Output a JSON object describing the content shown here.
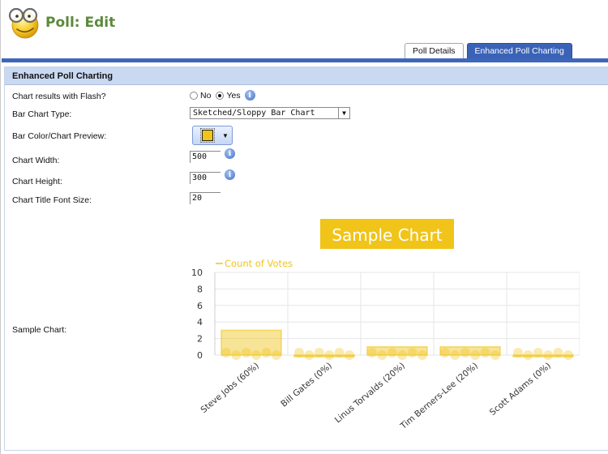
{
  "header": {
    "title": "Poll: Edit"
  },
  "tabs": [
    {
      "label": "Poll Details",
      "active": false
    },
    {
      "label": "Enhanced Poll Charting",
      "active": true
    }
  ],
  "section": {
    "title": "Enhanced Poll Charting"
  },
  "fields": {
    "flash": {
      "label": "Chart results with Flash?",
      "options": [
        "No",
        "Yes"
      ],
      "selected": "Yes"
    },
    "bar_chart_type": {
      "label": "Bar Chart Type:",
      "value": "Sketched/Sloppy Bar Chart"
    },
    "bar_color": {
      "label": "Bar Color/Chart Preview:",
      "color": "#f0c419"
    },
    "chart_width": {
      "label": "Chart Width:",
      "value": "500"
    },
    "chart_height": {
      "label": "Chart Height:",
      "value": "300"
    },
    "title_font_size": {
      "label": "Chart Title Font Size:",
      "value": "20"
    },
    "sample_chart": {
      "label": "Sample Chart:"
    }
  },
  "colors": {
    "accent": "#3a63b8",
    "bar": "#f0c419",
    "title_green": "#5b8a3c"
  },
  "icons": {
    "logo": "smiley-glasses-icon",
    "info": "info-icon"
  },
  "chart_data": {
    "type": "bar",
    "title": "Sample Chart",
    "legend": "Count of Votes",
    "legend_position": "top-left",
    "categories": [
      "Steve Jobs (60%)",
      "Bill Gates (0%)",
      "Linus Torvalds (20%)",
      "Tim Berners-Lee (20%)",
      "Scott Adams (0%)"
    ],
    "values": [
      3,
      0,
      1,
      1,
      0
    ],
    "ylim": [
      0,
      10
    ],
    "yticks": [
      0,
      2,
      4,
      6,
      8,
      10
    ],
    "grid": true
  }
}
